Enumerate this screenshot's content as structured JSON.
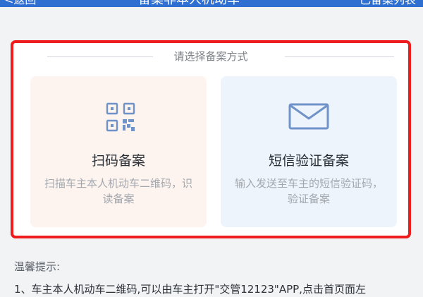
{
  "header": {
    "left_text": "<返回",
    "title": "备案非本人机动车",
    "right_text": "已备案列表"
  },
  "selection": {
    "prompt": "请选择备案方式",
    "options": [
      {
        "icon": "qr-code-icon",
        "title": "扫码备案",
        "description": "扫描车主本人机动车二维码，识读备案"
      },
      {
        "icon": "envelope-icon",
        "title": "短信验证备案",
        "description": "输入发送至车主的短信验证码，验证备案"
      }
    ]
  },
  "tips": {
    "title": "温馨提示:",
    "items": [
      "1、车主本人机动车二维码,可以由车主打开\"交管12123\"APP,点击首页面左"
    ]
  },
  "colors": {
    "header_bg": "#2f6fd1",
    "highlight_border": "#ee1c1c",
    "scan_card_bg": "#fdf4ef",
    "sms_card_bg": "#eef4fc",
    "icon_blue": "#6f93c8"
  }
}
